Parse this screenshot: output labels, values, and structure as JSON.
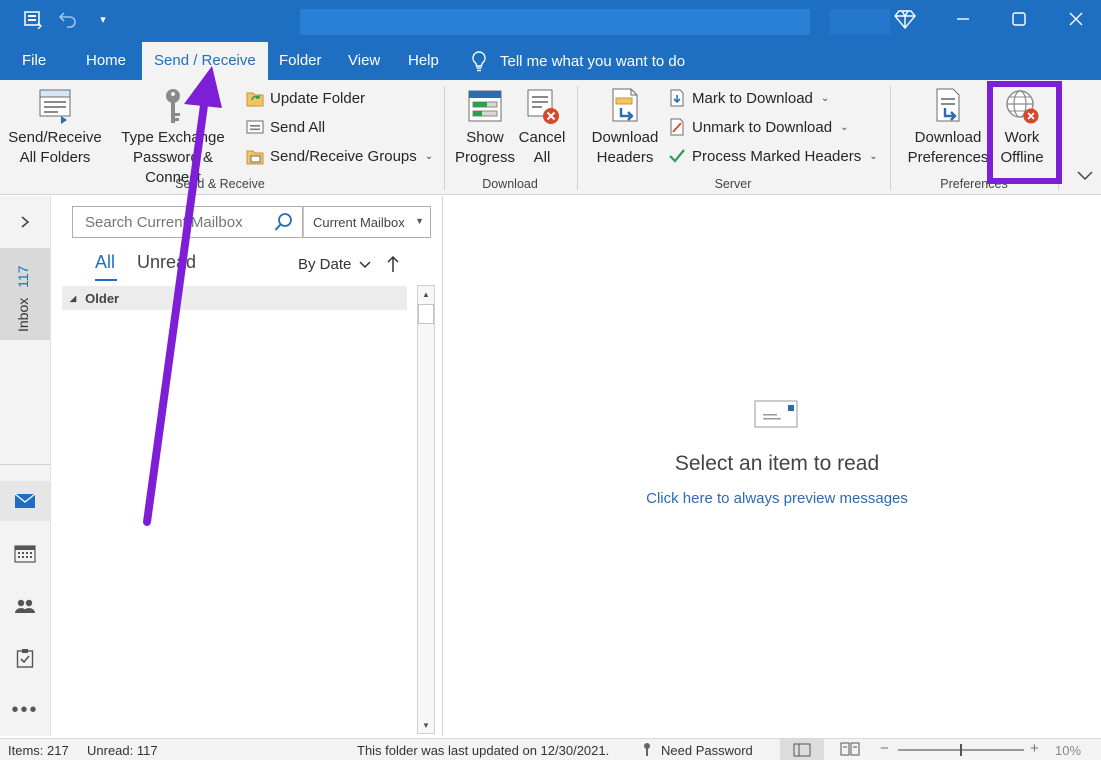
{
  "titlebar": {
    "icons": [
      "app-send-receive-icon",
      "undo-icon",
      "customize-qat-icon"
    ],
    "window_controls": {
      "premium": "diamond-icon",
      "minimize": "minimize-icon",
      "maximize": "maximize-icon",
      "close": "close-icon"
    }
  },
  "tabs": [
    {
      "label": "File"
    },
    {
      "label": "Home"
    },
    {
      "label": "Send / Receive",
      "active": true
    },
    {
      "label": "Folder"
    },
    {
      "label": "View"
    },
    {
      "label": "Help"
    }
  ],
  "tellme": {
    "label": "Tell me what you want to do",
    "icon": "lightbulb-icon"
  },
  "ribbon": {
    "send_receive": {
      "group_label": "Send & Receive",
      "send_receive_all": {
        "line1": "Send/Receive",
        "line2": "All Folders"
      },
      "type_exchange": {
        "line1": "Type Exchange",
        "line2": "Password & Connect"
      },
      "update_folder": "Update Folder",
      "send_all": "Send All",
      "send_receive_groups": "Send/Receive Groups"
    },
    "download": {
      "group_label": "Download",
      "show_progress": {
        "line1": "Show",
        "line2": "Progress"
      },
      "cancel_all": {
        "line1": "Cancel",
        "line2": "All"
      }
    },
    "server": {
      "group_label": "Server",
      "download_headers": {
        "line1": "Download",
        "line2": "Headers"
      },
      "mark_to_download": "Mark to Download",
      "unmark_to_download": "Unmark to Download",
      "process_marked_headers": "Process Marked Headers"
    },
    "preferences": {
      "group_label": "Preferences",
      "download_preferences": {
        "line1": "Download",
        "line2": "Preferences"
      },
      "work_offline": {
        "line1": "Work",
        "line2": "Offline"
      }
    }
  },
  "leftnav": {
    "inbox_label": "Inbox",
    "inbox_count": "117",
    "icons": [
      "mail-icon",
      "calendar-icon",
      "people-icon",
      "tasks-icon",
      "more-icon"
    ]
  },
  "list": {
    "search_placeholder": "Search Current Mailbox",
    "scope": "Current Mailbox",
    "filter_all": "All",
    "filter_unread": "Unread",
    "sort": "By Date",
    "group_older": "Older"
  },
  "reading": {
    "empty_title": "Select an item to read",
    "preview_link": "Click here to always preview messages"
  },
  "status": {
    "items": "Items: 217",
    "unread": "Unread: 117",
    "last_updated": "This folder was last updated on 12/30/2021.",
    "need_password": "Need Password",
    "zoom": "10%"
  },
  "colors": {
    "brand": "#1e6fc2",
    "annotation": "#7e1fd8",
    "link": "#2b6cb5"
  }
}
